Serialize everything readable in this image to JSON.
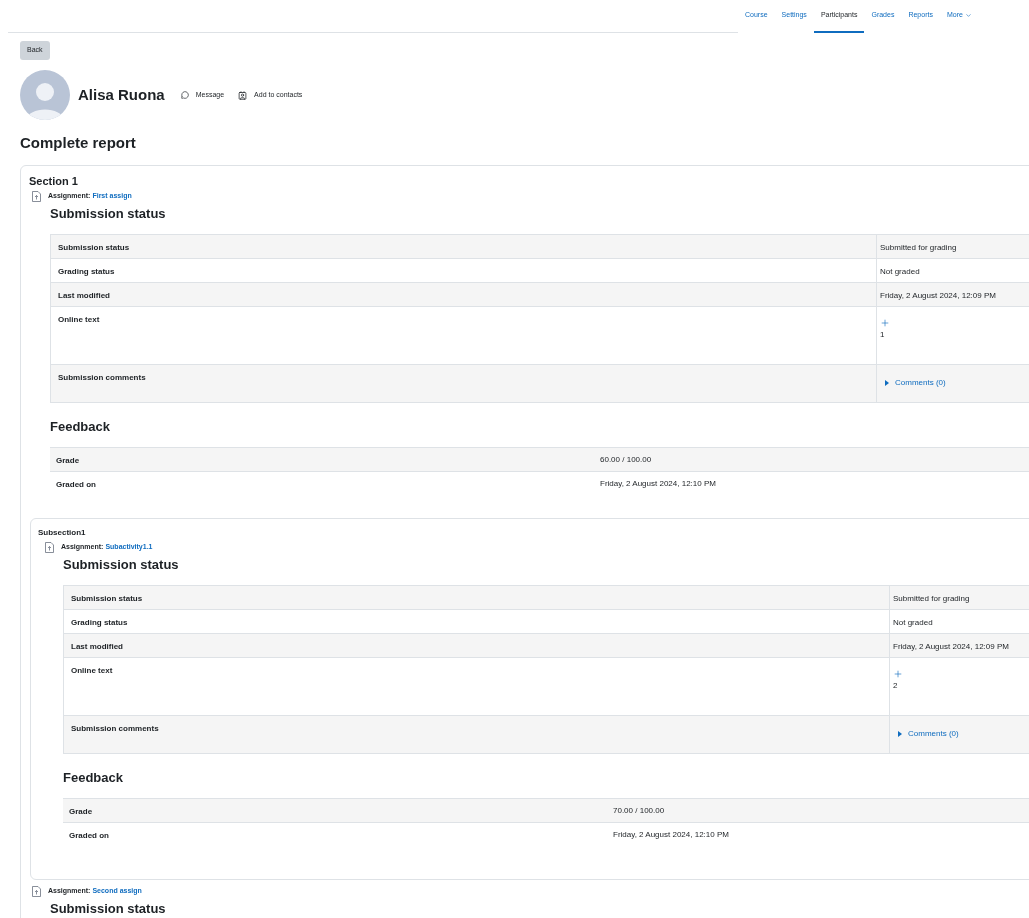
{
  "nav": {
    "tabs": [
      {
        "label": "Course",
        "selected": false
      },
      {
        "label": "Settings",
        "selected": false
      },
      {
        "label": "Participants",
        "selected": true
      },
      {
        "label": "Grades",
        "selected": false
      },
      {
        "label": "Reports",
        "selected": false
      },
      {
        "label": "More",
        "selected": false,
        "kind": "menu"
      }
    ]
  },
  "back_button": "Back",
  "profile": {
    "name": "Alisa Ruona",
    "actions": [
      {
        "label": "Message",
        "kind": "message"
      },
      {
        "label": "Add to contacts",
        "kind": "contact"
      }
    ]
  },
  "report_title": "Complete report",
  "sections": [
    {
      "title": "Section 1",
      "items": [
        {
          "kind": "assignment",
          "label": "Assignment:",
          "link": "First assign",
          "submission_heading": "Submission status",
          "submission_rows": [
            {
              "kind": "text",
              "label": "Submission status",
              "value": "Submitted for grading"
            },
            {
              "kind": "text",
              "label": "Grading status",
              "value": "Not graded"
            },
            {
              "kind": "text",
              "label": "Last modified",
              "value": "Friday, 2 August 2024, 12:09 PM"
            },
            {
              "kind": "online_text",
              "label": "Online text",
              "value": "1"
            },
            {
              "kind": "comments",
              "label": "Submission comments",
              "value": "Comments (0)"
            }
          ],
          "feedback_heading": "Feedback",
          "feedback_rows": [
            {
              "label": "Grade",
              "value": "60.00 / 100.00"
            },
            {
              "label": "Graded on",
              "value": "Friday, 2 August 2024, 12:10 PM"
            }
          ]
        },
        {
          "kind": "subsection",
          "title": "Subsection1",
          "items": [
            {
              "kind": "assignment",
              "label": "Assignment:",
              "link": "Subactivity1.1",
              "submission_heading": "Submission status",
              "submission_rows": [
                {
                  "kind": "text",
                  "label": "Submission status",
                  "value": "Submitted for grading"
                },
                {
                  "kind": "text",
                  "label": "Grading status",
                  "value": "Not graded"
                },
                {
                  "kind": "text",
                  "label": "Last modified",
                  "value": "Friday, 2 August 2024, 12:09 PM"
                },
                {
                  "kind": "online_text",
                  "label": "Online text",
                  "value": "2"
                },
                {
                  "kind": "comments",
                  "label": "Submission comments",
                  "value": "Comments (0)"
                }
              ],
              "feedback_heading": "Feedback",
              "feedback_rows": [
                {
                  "label": "Grade",
                  "value": "70.00 / 100.00"
                },
                {
                  "label": "Graded on",
                  "value": "Friday, 2 August 2024, 12:10 PM"
                }
              ]
            }
          ]
        },
        {
          "kind": "assignment",
          "label": "Assignment:",
          "link": "Second assign",
          "submission_heading": "Submission status"
        }
      ]
    }
  ]
}
